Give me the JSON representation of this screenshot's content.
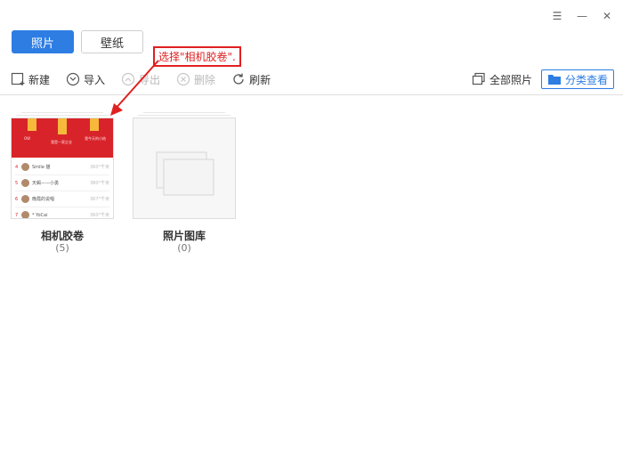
{
  "window_controls": {
    "menu": "☰",
    "minimize": "—",
    "close": "✕"
  },
  "tabs": [
    {
      "label": "照片",
      "active": true
    },
    {
      "label": "壁纸",
      "active": false
    }
  ],
  "toolbar": {
    "new_label": "新建",
    "import_label": "导入",
    "export_label": "导出",
    "delete_label": "删除",
    "refresh_label": "刷新",
    "all_photos_label": "全部照片",
    "category_view_label": "分类查看"
  },
  "annotation": {
    "text": "选择\"相机胶卷\"."
  },
  "albums": [
    {
      "name": "相机胶卷",
      "count": "(5)",
      "preview": {
        "header_left": "OW",
        "header_mid": "我是一家企业",
        "header_right": "我今天的小结",
        "rows": [
          {
            "num": "4",
            "name": "Smile 猫",
            "right": "360°千米"
          },
          {
            "num": "5",
            "name": "天蝎——小勇",
            "right": "380°千米"
          },
          {
            "num": "6",
            "name": "晚霞的说唱",
            "right": "367°千米"
          },
          {
            "num": "7",
            "name": "* YoCai",
            "right": "360°千米"
          }
        ]
      }
    },
    {
      "name": "照片图库",
      "count": "(0)"
    }
  ],
  "colors": {
    "accent": "#2d7de3",
    "annotation": "#e02020",
    "thumb_red": "#d8232a"
  }
}
